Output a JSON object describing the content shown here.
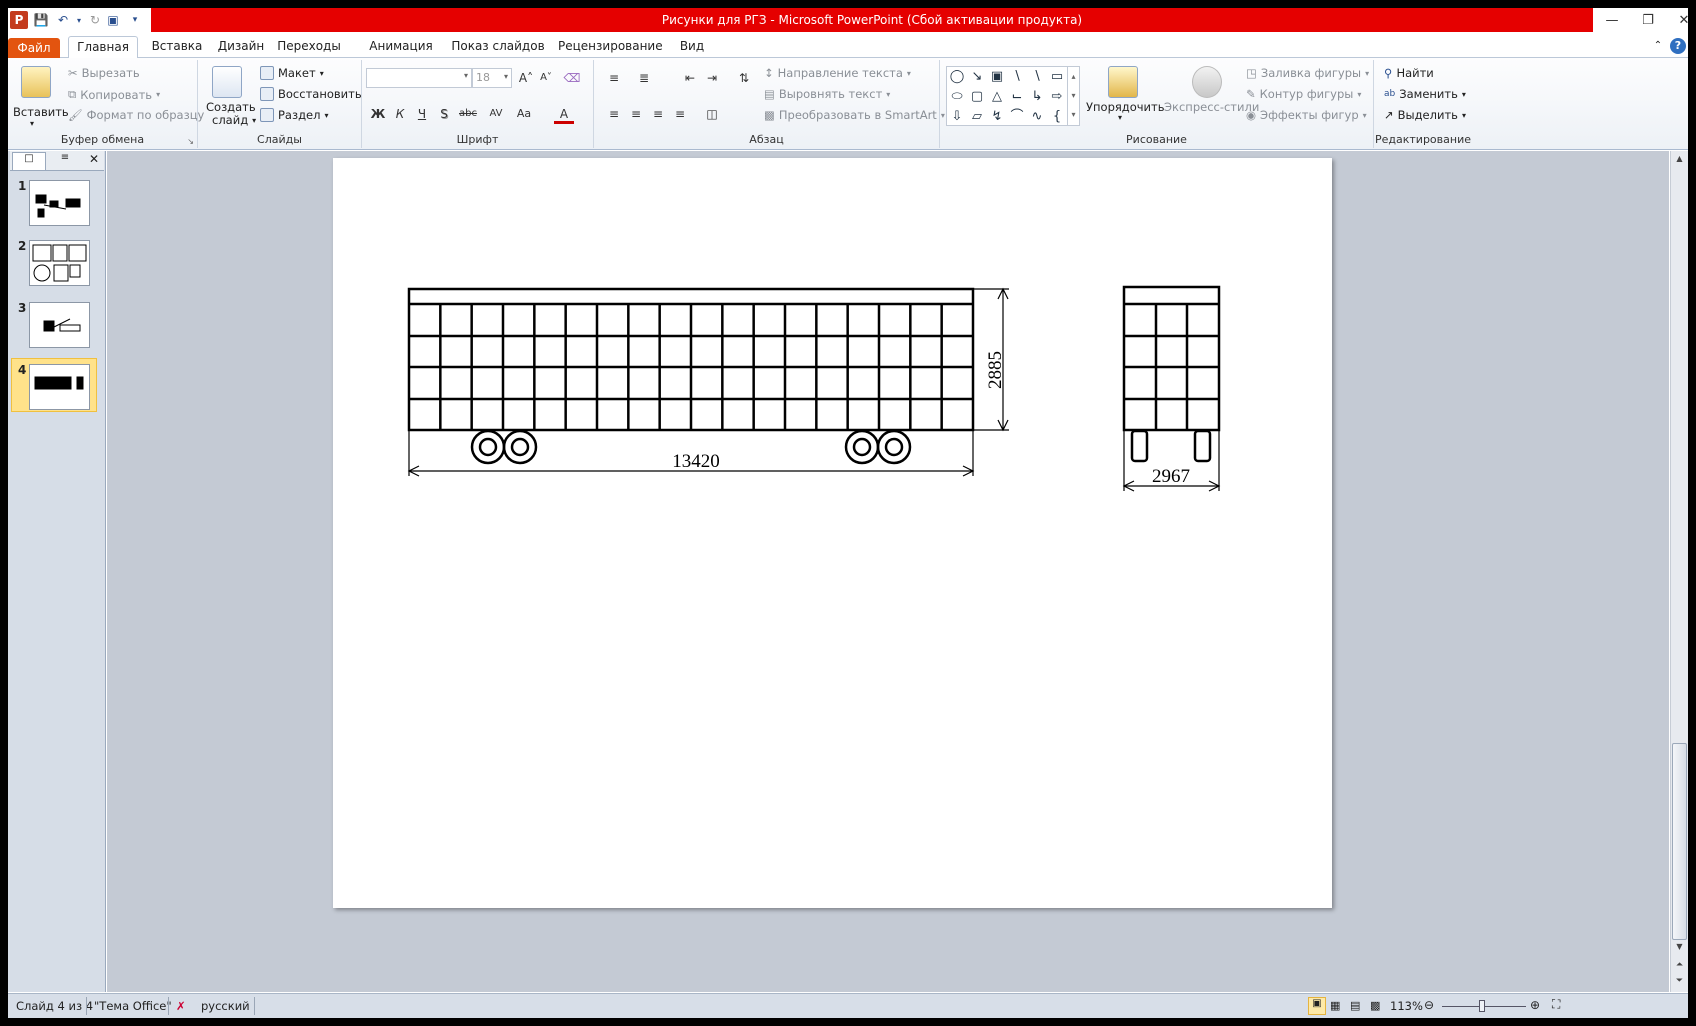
{
  "window": {
    "title": "Рисунки для РГЗ  -  Microsoft PowerPoint (Сбой активации продукта)"
  },
  "tabs": [
    {
      "label": "Файл"
    },
    {
      "label": "Главная"
    },
    {
      "label": "Вставка"
    },
    {
      "label": "Дизайн"
    },
    {
      "label": "Переходы"
    },
    {
      "label": "Анимация"
    },
    {
      "label": "Показ слайдов"
    },
    {
      "label": "Рецензирование"
    },
    {
      "label": "Вид"
    }
  ],
  "ribbon": {
    "clipboard": {
      "paste": "Вставить",
      "cut": "Вырезать",
      "copy": "Копировать",
      "format_painter": "Формат по образцу",
      "label": "Буфер обмена"
    },
    "slides": {
      "new_slide_1": "Создать",
      "new_slide_2": "слайд",
      "layout": "Макет",
      "reset": "Восстановить",
      "section": "Раздел",
      "label": "Слайды"
    },
    "font": {
      "size": "18",
      "bold": "Ж",
      "italic": "К",
      "underline": "Ч",
      "shadow": "S",
      "strike": "abc",
      "spacing": "AV",
      "case": "Aa",
      "color": "A",
      "label": "Шрифт"
    },
    "paragraph": {
      "text_direction": "Направление текста",
      "align_text": "Выровнять текст",
      "smartart": "Преобразовать в SmartArt",
      "label": "Абзац"
    },
    "drawing": {
      "arrange": "Упорядочить",
      "quick_styles": "Экспресс-стили",
      "fill": "Заливка фигуры",
      "outline": "Контур фигуры",
      "effects": "Эффекты фигур",
      "label": "Рисование"
    },
    "editing": {
      "find": "Найти",
      "replace": "Заменить",
      "select": "Выделить",
      "label": "Редактирование"
    }
  },
  "thumbnails": [
    {
      "num": "1"
    },
    {
      "num": "2"
    },
    {
      "num": "3"
    },
    {
      "num": "4"
    }
  ],
  "slide": {
    "length_dim": "13420",
    "height_dim": "2885",
    "width_dim": "2967"
  },
  "status": {
    "slide_info": "Слайд 4 из 4",
    "theme": "\"Тема Office\"",
    "language": "русский",
    "zoom": "113%"
  },
  "colors": {
    "title_bar": "#e50000",
    "file_tab": "#e3540f",
    "selected_thumb": "#ffe28a"
  }
}
